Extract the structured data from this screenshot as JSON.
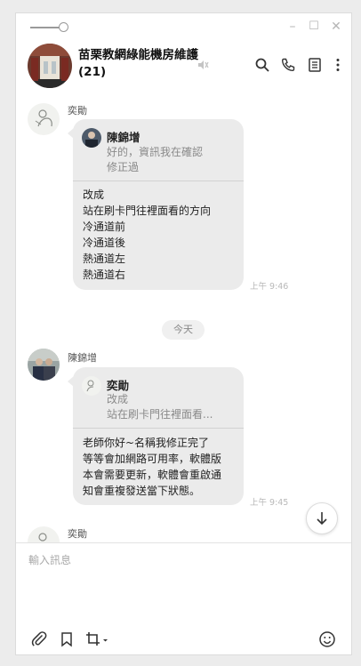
{
  "window_controls": {
    "minimize": "–",
    "maximize": "☐",
    "close": "✕"
  },
  "chat": {
    "title": "苗栗教網綠能機房維護 (21)"
  },
  "messages": [
    {
      "sender": "奕勛",
      "quote": {
        "name": "陳錦增",
        "lines": [
          "好的，資訊我在確認",
          "修正過"
        ]
      },
      "lines": [
        "改成",
        "站在刷卡門往裡面看的方向",
        "冷通道前",
        "冷通道後",
        "熱通道左",
        "熱通道右"
      ],
      "time": "上午 9:46"
    },
    {
      "sender": "陳錦增",
      "quote": {
        "name": "奕勛",
        "lines": [
          "改成",
          "站在刷卡門往裡面看..."
        ]
      },
      "lines": [
        "老師你好~名稱我修正完了",
        "等等會加網路可用率，軟體版",
        "本會需要更新，軟體會重啟通",
        "知會重複發送當下狀態。"
      ],
      "time": "上午 9:45"
    },
    {
      "sender": "奕勛"
    }
  ],
  "date_divider": "今天",
  "input": {
    "placeholder": "輸入訊息"
  }
}
